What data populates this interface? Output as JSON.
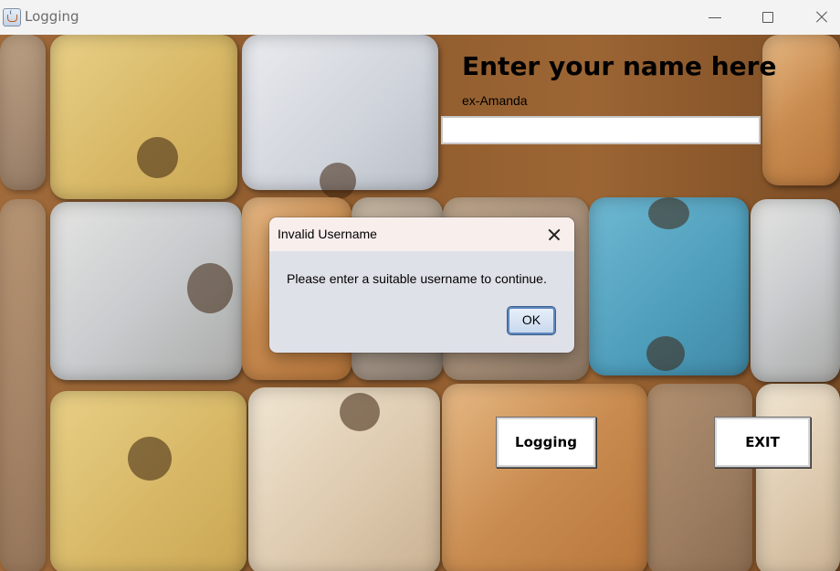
{
  "window": {
    "title": "Logging",
    "icon": "java-cup-icon"
  },
  "form": {
    "heading": "Enter your name here",
    "hint": "ex-Amanda",
    "name_value": "",
    "logging_button": "Logging",
    "exit_button": "EXIT"
  },
  "dialog": {
    "title": "Invalid Username",
    "message": "Please enter a suitable username to continue.",
    "ok_label": "OK"
  },
  "colors": {
    "accent": "#3a5f8f",
    "titlebar": "#f3f3f3",
    "dialog_bg": "#dfe1e8"
  }
}
